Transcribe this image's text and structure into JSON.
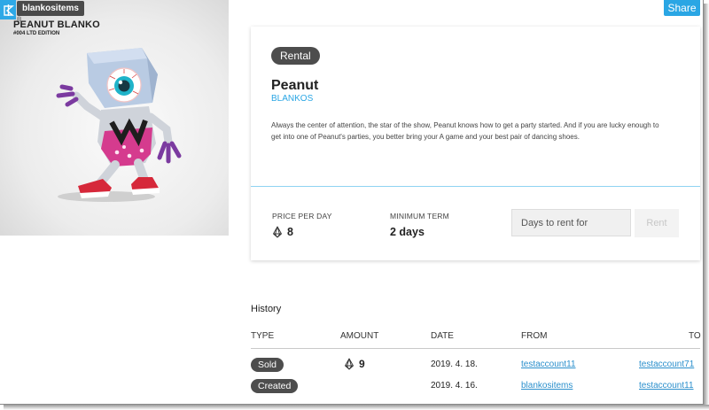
{
  "app": {
    "accent": "#2aa6e4"
  },
  "image": {
    "tag": "blankositems",
    "brand_line1": "PEANUT BLANKO",
    "brand_line2": "#004 LTD EDITION",
    "brand_mark": "®"
  },
  "share_label": "Share",
  "item": {
    "badge": "Rental",
    "name": "Peanut",
    "brand": "BLANKOS",
    "description": "Always the center of attention, the star of the show, Peanut knows how to get a party started. And if you are lucky enough to get into one of Peanut's parties, you better bring your A game and your best pair of dancing shoes.",
    "price_label": "PRICE PER DAY",
    "price_value": "8",
    "price_icon": "eos-token-icon",
    "term_label": "MINIMUM TERM",
    "term_value": "2 days",
    "days_placeholder": "Days to rent for",
    "rent_label": "Rent"
  },
  "history": {
    "title": "History",
    "columns": {
      "type": "TYPE",
      "amount": "AMOUNT",
      "date": "DATE",
      "from": "FROM",
      "to": "TO"
    },
    "rows": [
      {
        "type": "Sold",
        "amount": "9",
        "date": "2019. 4. 18.",
        "from": "testaccount11",
        "to": "testaccount71"
      },
      {
        "type": "Created",
        "amount": "",
        "date": "2019. 4. 16.",
        "from": "blankositems",
        "to": "testaccount11"
      }
    ]
  }
}
